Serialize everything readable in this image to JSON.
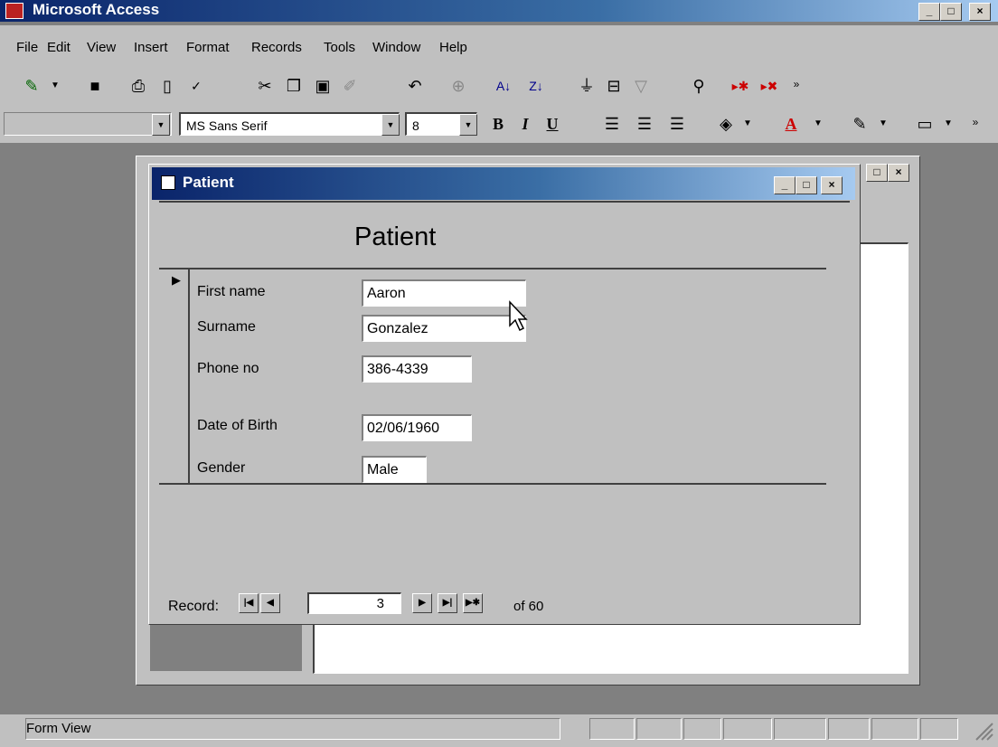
{
  "app": {
    "title": "Microsoft Access"
  },
  "menu": [
    "File",
    "Edit",
    "View",
    "Insert",
    "Format",
    "Records",
    "Tools",
    "Window",
    "Help"
  ],
  "formatting": {
    "font_name": "MS Sans Serif",
    "font_size": "8",
    "bold": "B",
    "italic": "I",
    "underline": "U"
  },
  "form": {
    "window_title": "Patient",
    "heading": "Patient",
    "fields": [
      {
        "label": "First name",
        "value": "Aaron"
      },
      {
        "label": "Surname",
        "value": "Gonzalez"
      },
      {
        "label": "Phone no",
        "value": "386-4339"
      },
      {
        "label": "Date of Birth",
        "value": "02/06/1960"
      },
      {
        "label": "Gender",
        "value": "Male"
      }
    ],
    "record_nav": {
      "label": "Record:",
      "current": "3",
      "of_text": "of 60"
    }
  },
  "status": {
    "text": "Form View"
  },
  "icons": [
    "view-icon",
    "save-icon",
    "print-icon",
    "print-preview-icon",
    "spelling-icon",
    "cut-icon",
    "copy-icon",
    "paste-icon",
    "format-painter-icon",
    "undo-icon",
    "hyperlink-icon",
    "sort-ascending-icon",
    "sort-descending-icon",
    "filter-by-selection-icon",
    "filter-by-form-icon",
    "apply-filter-icon",
    "find-icon",
    "new-record-icon",
    "delete-record-icon",
    "more-buttons-icon"
  ],
  "colors": {
    "titlebar": "#0a246a",
    "face": "#c0c0c0",
    "desktop": "#808080"
  }
}
